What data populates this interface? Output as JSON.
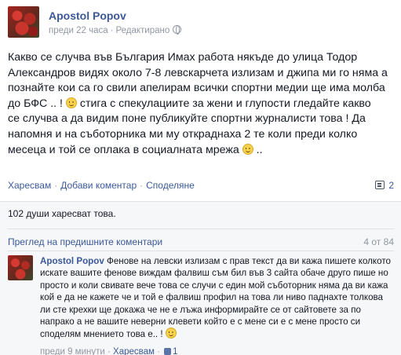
{
  "post": {
    "author": "Apostol Popov",
    "time": "преди 22 часа",
    "edited": "Редактирано",
    "privacy_icon": "globe-icon",
    "text_part1": "Какво се случва във България Имах работа някъде до улица Тодор\nАлександров видях около 7-8 левскарчета излизам и джипа ми го няма а\nпознайте кои са го свили апелирам всички спортни медии ще има молба\nдо БФС .. ! ",
    "text_part2": " стига с спекулациите за жени и глупости гледайте какво\nсе случва а да видим поне публикуйте спортни журналисти това ! Да\nнапомня и на съботорника ми му откраднаха 2 те коли преди колко\nмесеца и той се оплака в социалната мрежа ",
    "text_part3": " .."
  },
  "actions": {
    "like": "Харесвам",
    "comment": "Добави коментар",
    "share": "Споделяне",
    "comment_count": "2"
  },
  "likes": {
    "text": "102 души харесват това."
  },
  "comments_header": {
    "prev_link": "Преглед на предишните коментари",
    "counter": "4 от 84"
  },
  "comment": {
    "author": "Apostol Popov",
    "text": "Фенове на левски излизам с прав текст да ви кажа пишете колкото искате вашите фенове виждам фалвиш съм бил във 3 сайта обаче друго пише но просто и коли свивате вече това се случи с един мой съботорник няма да ви кажа кой е да не кажете че и той е фалвиш профил на това ли ниво паднахте толкова ли сте крехки ще докажа че не е лъжа информирайте се от сайтовете за по напрако а не вашите неверни клевети който е с мене си е с мене просто си споделям мнението това е.. ! ",
    "time": "преди 9 минути",
    "like": "Харесвам",
    "like_count": "1"
  },
  "colors": {
    "link": "#3b5998",
    "meta": "#9197a3",
    "ufi_bg": "#f6f7f8"
  }
}
